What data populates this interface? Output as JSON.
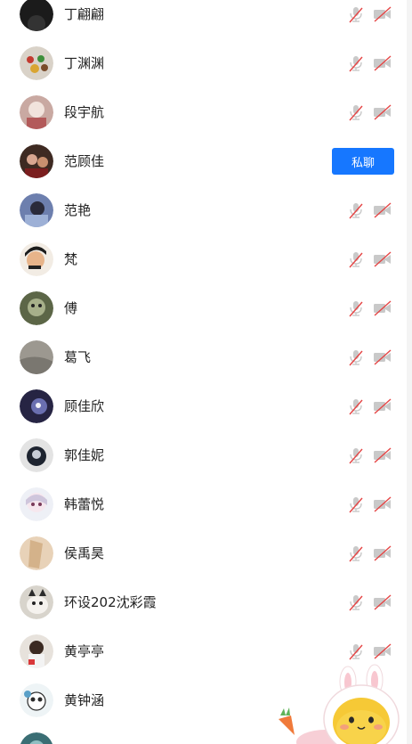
{
  "colors": {
    "accent": "#1677ff",
    "muted_icon": "#c9c9c9",
    "slash": "#e54545"
  },
  "participants": [
    {
      "name": "丁翩翩",
      "mic_icon": "mic-muted-icon",
      "cam_icon": "camera-off-icon"
    },
    {
      "name": "丁渊渊",
      "mic_icon": "mic-muted-icon",
      "cam_icon": "camera-off-icon"
    },
    {
      "name": "段宇航",
      "mic_icon": "mic-muted-icon",
      "cam_icon": "camera-off-icon"
    },
    {
      "name": "范顾佳",
      "action_label": "私聊"
    },
    {
      "name": "范艳",
      "mic_icon": "mic-muted-icon",
      "cam_icon": "camera-off-icon"
    },
    {
      "name": "梵",
      "mic_icon": "mic-muted-icon",
      "cam_icon": "camera-off-icon"
    },
    {
      "name": "傅",
      "mic_icon": "mic-muted-icon",
      "cam_icon": "camera-off-icon"
    },
    {
      "name": "葛飞",
      "mic_icon": "mic-muted-icon",
      "cam_icon": "camera-off-icon"
    },
    {
      "name": "顾佳欣",
      "mic_icon": "mic-muted-icon",
      "cam_icon": "camera-off-icon"
    },
    {
      "name": "郭佳妮",
      "mic_icon": "mic-muted-icon",
      "cam_icon": "camera-off-icon"
    },
    {
      "name": "韩蕾悦",
      "mic_icon": "mic-muted-icon",
      "cam_icon": "camera-off-icon"
    },
    {
      "name": "侯禹昊",
      "mic_icon": "mic-muted-icon",
      "cam_icon": "camera-off-icon"
    },
    {
      "name": "环设202沈彩霞",
      "mic_icon": "mic-muted-icon",
      "cam_icon": "camera-off-icon"
    },
    {
      "name": "黄亭亭",
      "mic_icon": "mic-muted-icon",
      "cam_icon": "camera-off-icon"
    },
    {
      "name": "黄钟涵"
    },
    {
      "name": ""
    }
  ]
}
